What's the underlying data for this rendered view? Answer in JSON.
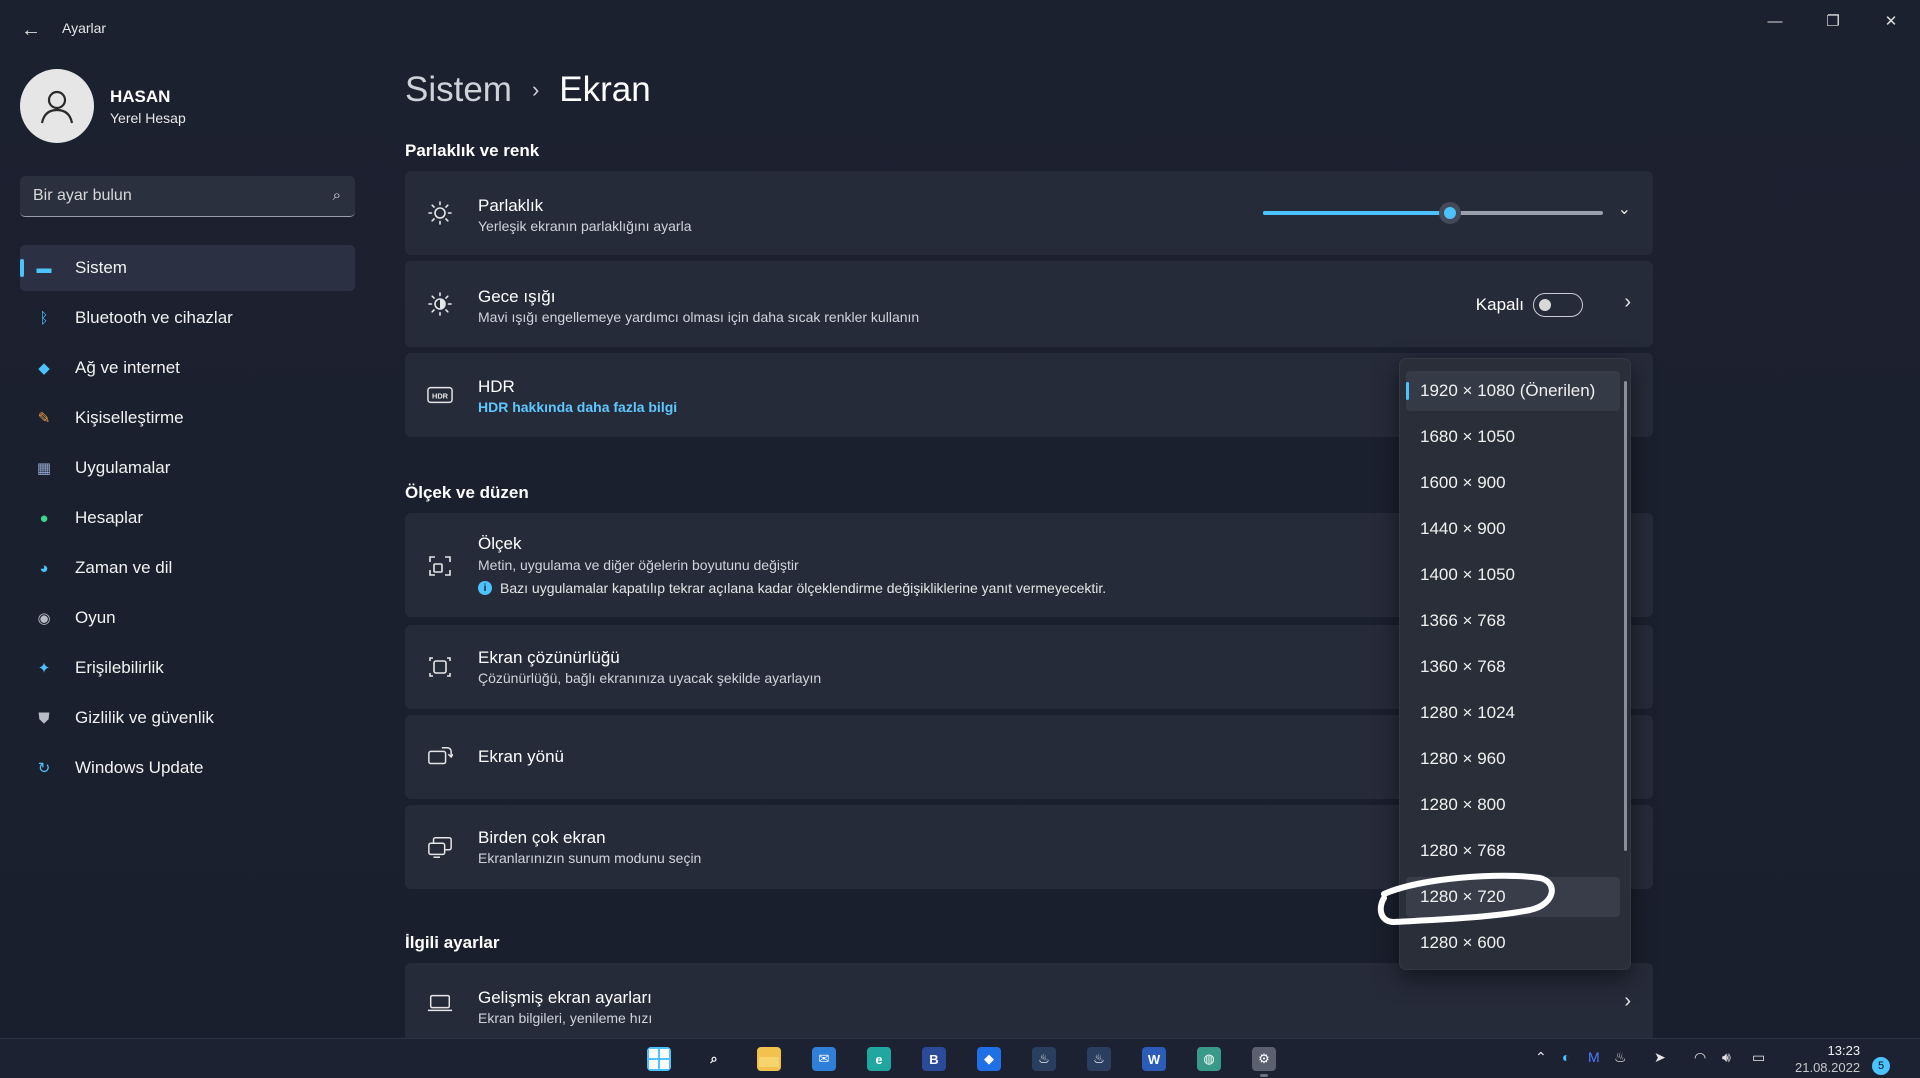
{
  "titlebar": {
    "back_icon": "back-arrow-icon",
    "app_title": "Ayarlar",
    "minimize": "—",
    "maximize": "❐",
    "close": "✕"
  },
  "profile": {
    "name": "HASAN",
    "account_type": "Yerel Hesap"
  },
  "search": {
    "placeholder": "Bir ayar bulun",
    "icon": "search-icon"
  },
  "sidebar": {
    "items": [
      {
        "label": "Sistem",
        "icon": "system-icon",
        "color": "#4cc2ff",
        "active": true
      },
      {
        "label": "Bluetooth ve cihazlar",
        "icon": "bluetooth-icon",
        "color": "#4cc2ff"
      },
      {
        "label": "Ağ ve internet",
        "icon": "wifi-icon",
        "color": "#4cc2ff"
      },
      {
        "label": "Kişiselleştirme",
        "icon": "brush-icon",
        "color": "#f0a040"
      },
      {
        "label": "Uygulamalar",
        "icon": "apps-icon",
        "color": "#8fa3c8"
      },
      {
        "label": "Hesaplar",
        "icon": "account-icon",
        "color": "#3dd68c"
      },
      {
        "label": "Zaman ve dil",
        "icon": "globe-clock-icon",
        "color": "#4cc2ff"
      },
      {
        "label": "Oyun",
        "icon": "gamepad-icon",
        "color": "#b8bcc6"
      },
      {
        "label": "Erişilebilirlik",
        "icon": "accessibility-icon",
        "color": "#4cc2ff"
      },
      {
        "label": "Gizlilik ve güvenlik",
        "icon": "shield-icon",
        "color": "#b8bcc6"
      },
      {
        "label": "Windows Update",
        "icon": "update-icon",
        "color": "#4cc2ff"
      }
    ]
  },
  "breadcrumb": {
    "parent": "Sistem",
    "separator": "›",
    "current": "Ekran"
  },
  "sections": {
    "brightness_color": "Parlaklık ve renk",
    "scale_layout": "Ölçek ve düzen",
    "related": "İlgili ayarlar"
  },
  "cards": {
    "brightness": {
      "title": "Parlaklık",
      "subtitle": "Yerleşik ekranın parlaklığını ayarla",
      "value": 0.55
    },
    "night_light": {
      "title": "Gece ışığı",
      "subtitle": "Mavi ışığı engellemeye yardımcı olması için daha sıcak renkler kullanın",
      "state": "Kapalı"
    },
    "hdr": {
      "title": "HDR",
      "link": "HDR hakkında daha fazla bilgi"
    },
    "scale": {
      "title": "Ölçek",
      "subtitle": "Metin, uygulama ve diğer öğelerin boyutunu değiştir",
      "note": "Bazı uygulamalar kapatılıp tekrar açılana kadar ölçeklendirme değişikliklerine yanıt vermeyecektir."
    },
    "resolution": {
      "title": "Ekran çözünürlüğü",
      "subtitle": "Çözünürlüğü, bağlı ekranınıza uyacak şekilde ayarlayın"
    },
    "orientation": {
      "title": "Ekran yönü"
    },
    "multiple": {
      "title": "Birden çok ekran",
      "subtitle": "Ekranlarınızın sunum modunu seçin"
    },
    "advanced": {
      "title": "Gelişmiş ekran ayarları",
      "subtitle": "Ekran bilgileri, yenileme hızı"
    }
  },
  "resolution_dropdown": {
    "options": [
      "1920 × 1080 (Önerilen)",
      "1680 × 1050",
      "1600 × 900",
      "1440 × 900",
      "1400 × 1050",
      "1366 × 768",
      "1360 × 768",
      "1280 × 1024",
      "1280 × 960",
      "1280 × 800",
      "1280 × 768",
      "1280 × 720",
      "1280 × 600"
    ],
    "selected": "1920 × 1080 (Önerilen)",
    "highlighted": "1280 × 720"
  },
  "taskbar": {
    "apps": [
      {
        "name": "start-icon",
        "glyph": "",
        "color": "#4cc2ff"
      },
      {
        "name": "search-taskbar-icon",
        "glyph": "⌕",
        "color": "transparent"
      },
      {
        "name": "file-explorer-icon",
        "glyph": "",
        "color": "#f2c14e"
      },
      {
        "name": "mail-icon",
        "glyph": "✉",
        "color": "#2f7fd8"
      },
      {
        "name": "edge-icon",
        "glyph": "e",
        "color": "#1fa7a0"
      },
      {
        "name": "b-app-icon",
        "glyph": "B",
        "color": "#2b4a9a"
      },
      {
        "name": "dropbox-icon",
        "glyph": "◆",
        "color": "#1f6fe5"
      },
      {
        "name": "steam-icon",
        "glyph": "♨",
        "color": "#2a3f5f"
      },
      {
        "name": "steam-alt-icon",
        "glyph": "♨",
        "color": "#2a3f5f"
      },
      {
        "name": "word-icon",
        "glyph": "W",
        "color": "#2b5cb8"
      },
      {
        "name": "earth-icon",
        "glyph": "◍",
        "color": "#3a9a8a"
      },
      {
        "name": "settings-taskbar-icon",
        "glyph": "⚙",
        "color": "#5a6070"
      }
    ],
    "time": "13:23",
    "date": "21.08.2022",
    "notifications": "5"
  }
}
